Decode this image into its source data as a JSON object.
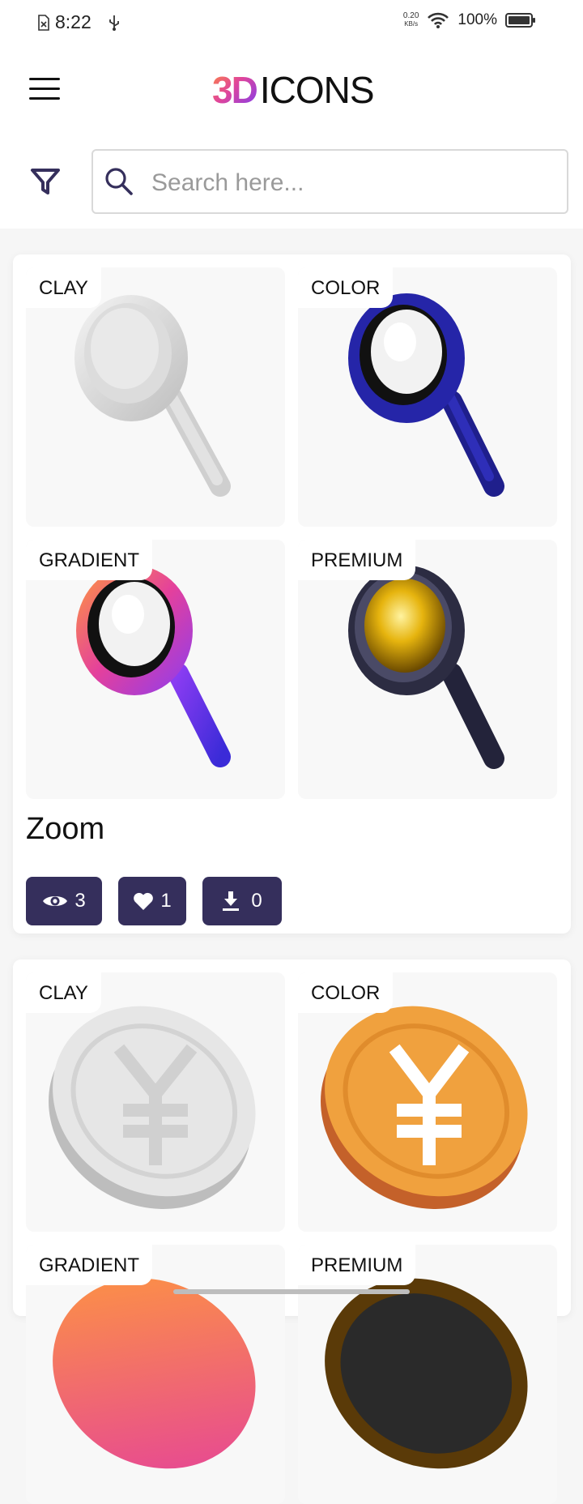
{
  "status_bar": {
    "time": "8:22",
    "net_speed_value": "0.20",
    "net_speed_unit": "KB/s",
    "battery": "100%"
  },
  "header": {
    "logo_3d": "3D",
    "logo_text": "ICONS",
    "logo_gradient": [
      "#ff8a3d",
      "#e0459b",
      "#7a3cf2"
    ]
  },
  "search": {
    "placeholder": "Search here...",
    "value": ""
  },
  "colors": {
    "accent": "#352f5c",
    "background": "#f6f6f6",
    "tile": "#f8f8f8"
  },
  "cards": [
    {
      "title": "Zoom",
      "variants": [
        {
          "label": "CLAY",
          "icon": "magnifier-clay-icon"
        },
        {
          "label": "COLOR",
          "icon": "magnifier-color-icon"
        },
        {
          "label": "GRADIENT",
          "icon": "magnifier-gradient-icon"
        },
        {
          "label": "PREMIUM",
          "icon": "magnifier-premium-icon"
        }
      ],
      "stats": {
        "views": "3",
        "likes": "1",
        "downloads": "0"
      }
    },
    {
      "variants": [
        {
          "label": "CLAY",
          "icon": "yen-coin-clay-icon"
        },
        {
          "label": "COLOR",
          "icon": "yen-coin-color-icon"
        },
        {
          "label": "GRADIENT",
          "icon": "yen-coin-gradient-icon"
        },
        {
          "label": "PREMIUM",
          "icon": "yen-coin-premium-icon"
        }
      ]
    }
  ]
}
